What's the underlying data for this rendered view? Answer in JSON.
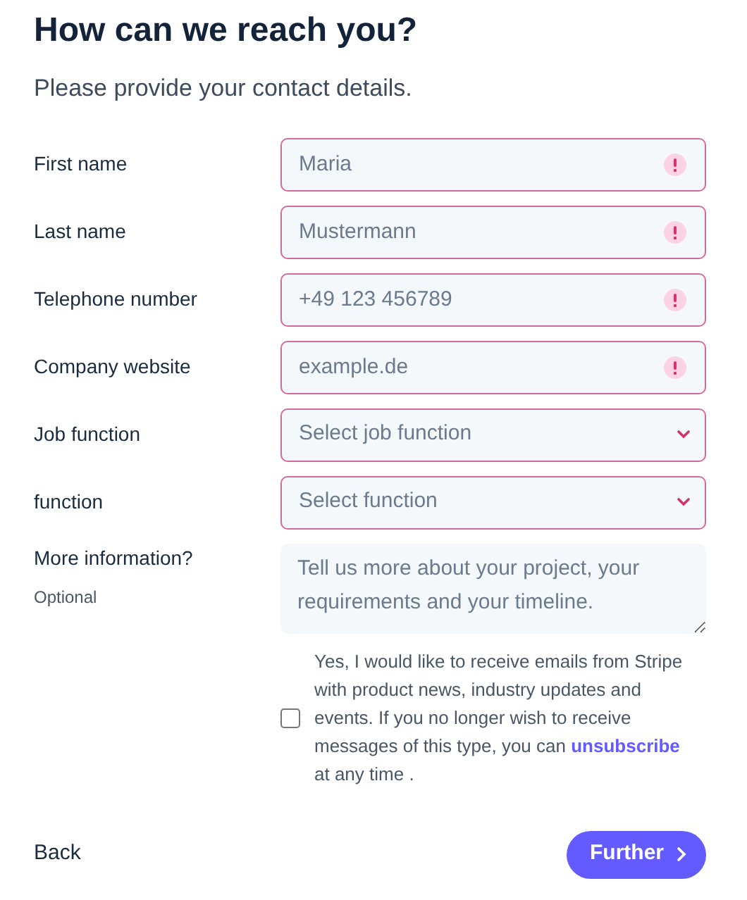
{
  "title": "How can we reach you?",
  "subtitle": "Please provide your contact details.",
  "fields": [
    {
      "label": "First name",
      "kind": "input",
      "placeholder": "Maria",
      "invalid": true
    },
    {
      "label": "Last name",
      "kind": "input",
      "placeholder": "Mustermann",
      "invalid": true
    },
    {
      "label": "Telephone number",
      "kind": "input",
      "placeholder": "+49 123 456789",
      "invalid": true
    },
    {
      "label": "Company website",
      "kind": "input",
      "placeholder": "example.de",
      "invalid": true
    },
    {
      "label": "Job function",
      "kind": "select",
      "placeholder": "Select job function",
      "invalid": true
    },
    {
      "label": "function",
      "kind": "select",
      "placeholder": "Select function",
      "invalid": true
    },
    {
      "label": "More information?",
      "hint": "Optional",
      "kind": "textarea",
      "placeholder": "Tell us more about your project, your requirements and your timeline.",
      "invalid": false
    }
  ],
  "consent": {
    "checked": false,
    "text_before": "Yes, I would like to receive emails from Stripe with product news, industry updates and events. If you no longer wish to receive messages of this type, you can",
    "link": "unsubscribe",
    "text_after": "at any time ."
  },
  "back": "Back",
  "further": "Further"
}
